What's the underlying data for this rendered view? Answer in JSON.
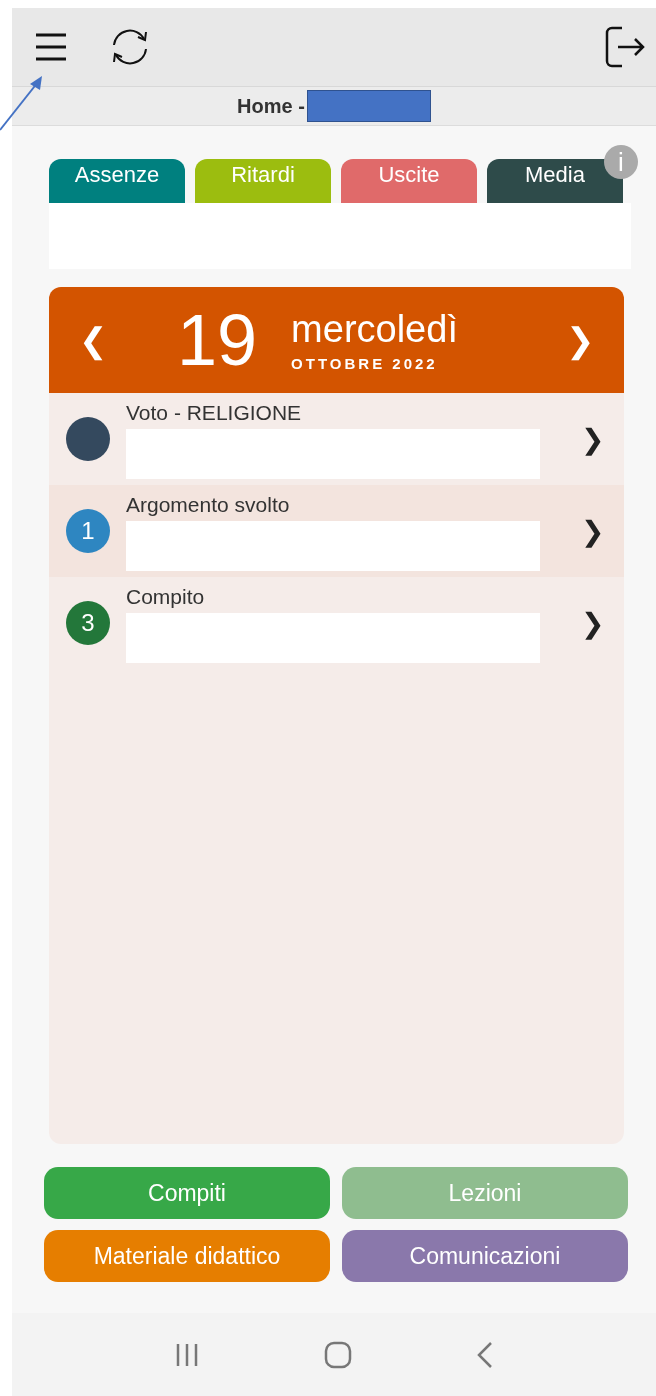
{
  "header": {
    "title": "Home -"
  },
  "tabs": [
    {
      "label": "Assenze",
      "color": "#00807f"
    },
    {
      "label": "Ritardi",
      "color": "#9cbd0f"
    },
    {
      "label": "Uscite",
      "color": "#e06a6a"
    },
    {
      "label": "Media",
      "color": "#2e4b4a"
    }
  ],
  "info_badge": "i",
  "calendar": {
    "prev": "❮",
    "day": "19",
    "weekday": "mercoledì",
    "month_year": "OTTOBRE 2022",
    "next": "❯",
    "events": [
      {
        "kind": "dot",
        "title": "Voto - RELIGIONE",
        "color": "#34495e",
        "arrow": "❯"
      },
      {
        "kind": "count",
        "title": "Argomento svolto",
        "count": "1",
        "color": "#2e86c1",
        "arrow": "❯"
      },
      {
        "kind": "count",
        "title": "Compito",
        "count": "3",
        "color": "#23773a",
        "arrow": "❯"
      }
    ]
  },
  "buttons": [
    {
      "label": "Compiti",
      "color": "#37a848"
    },
    {
      "label": "Lezioni",
      "color": "#8fbd8f"
    },
    {
      "label": "Materiale didattico",
      "color": "#e67e00"
    },
    {
      "label": "Comunicazioni",
      "color": "#8a78ab"
    }
  ]
}
